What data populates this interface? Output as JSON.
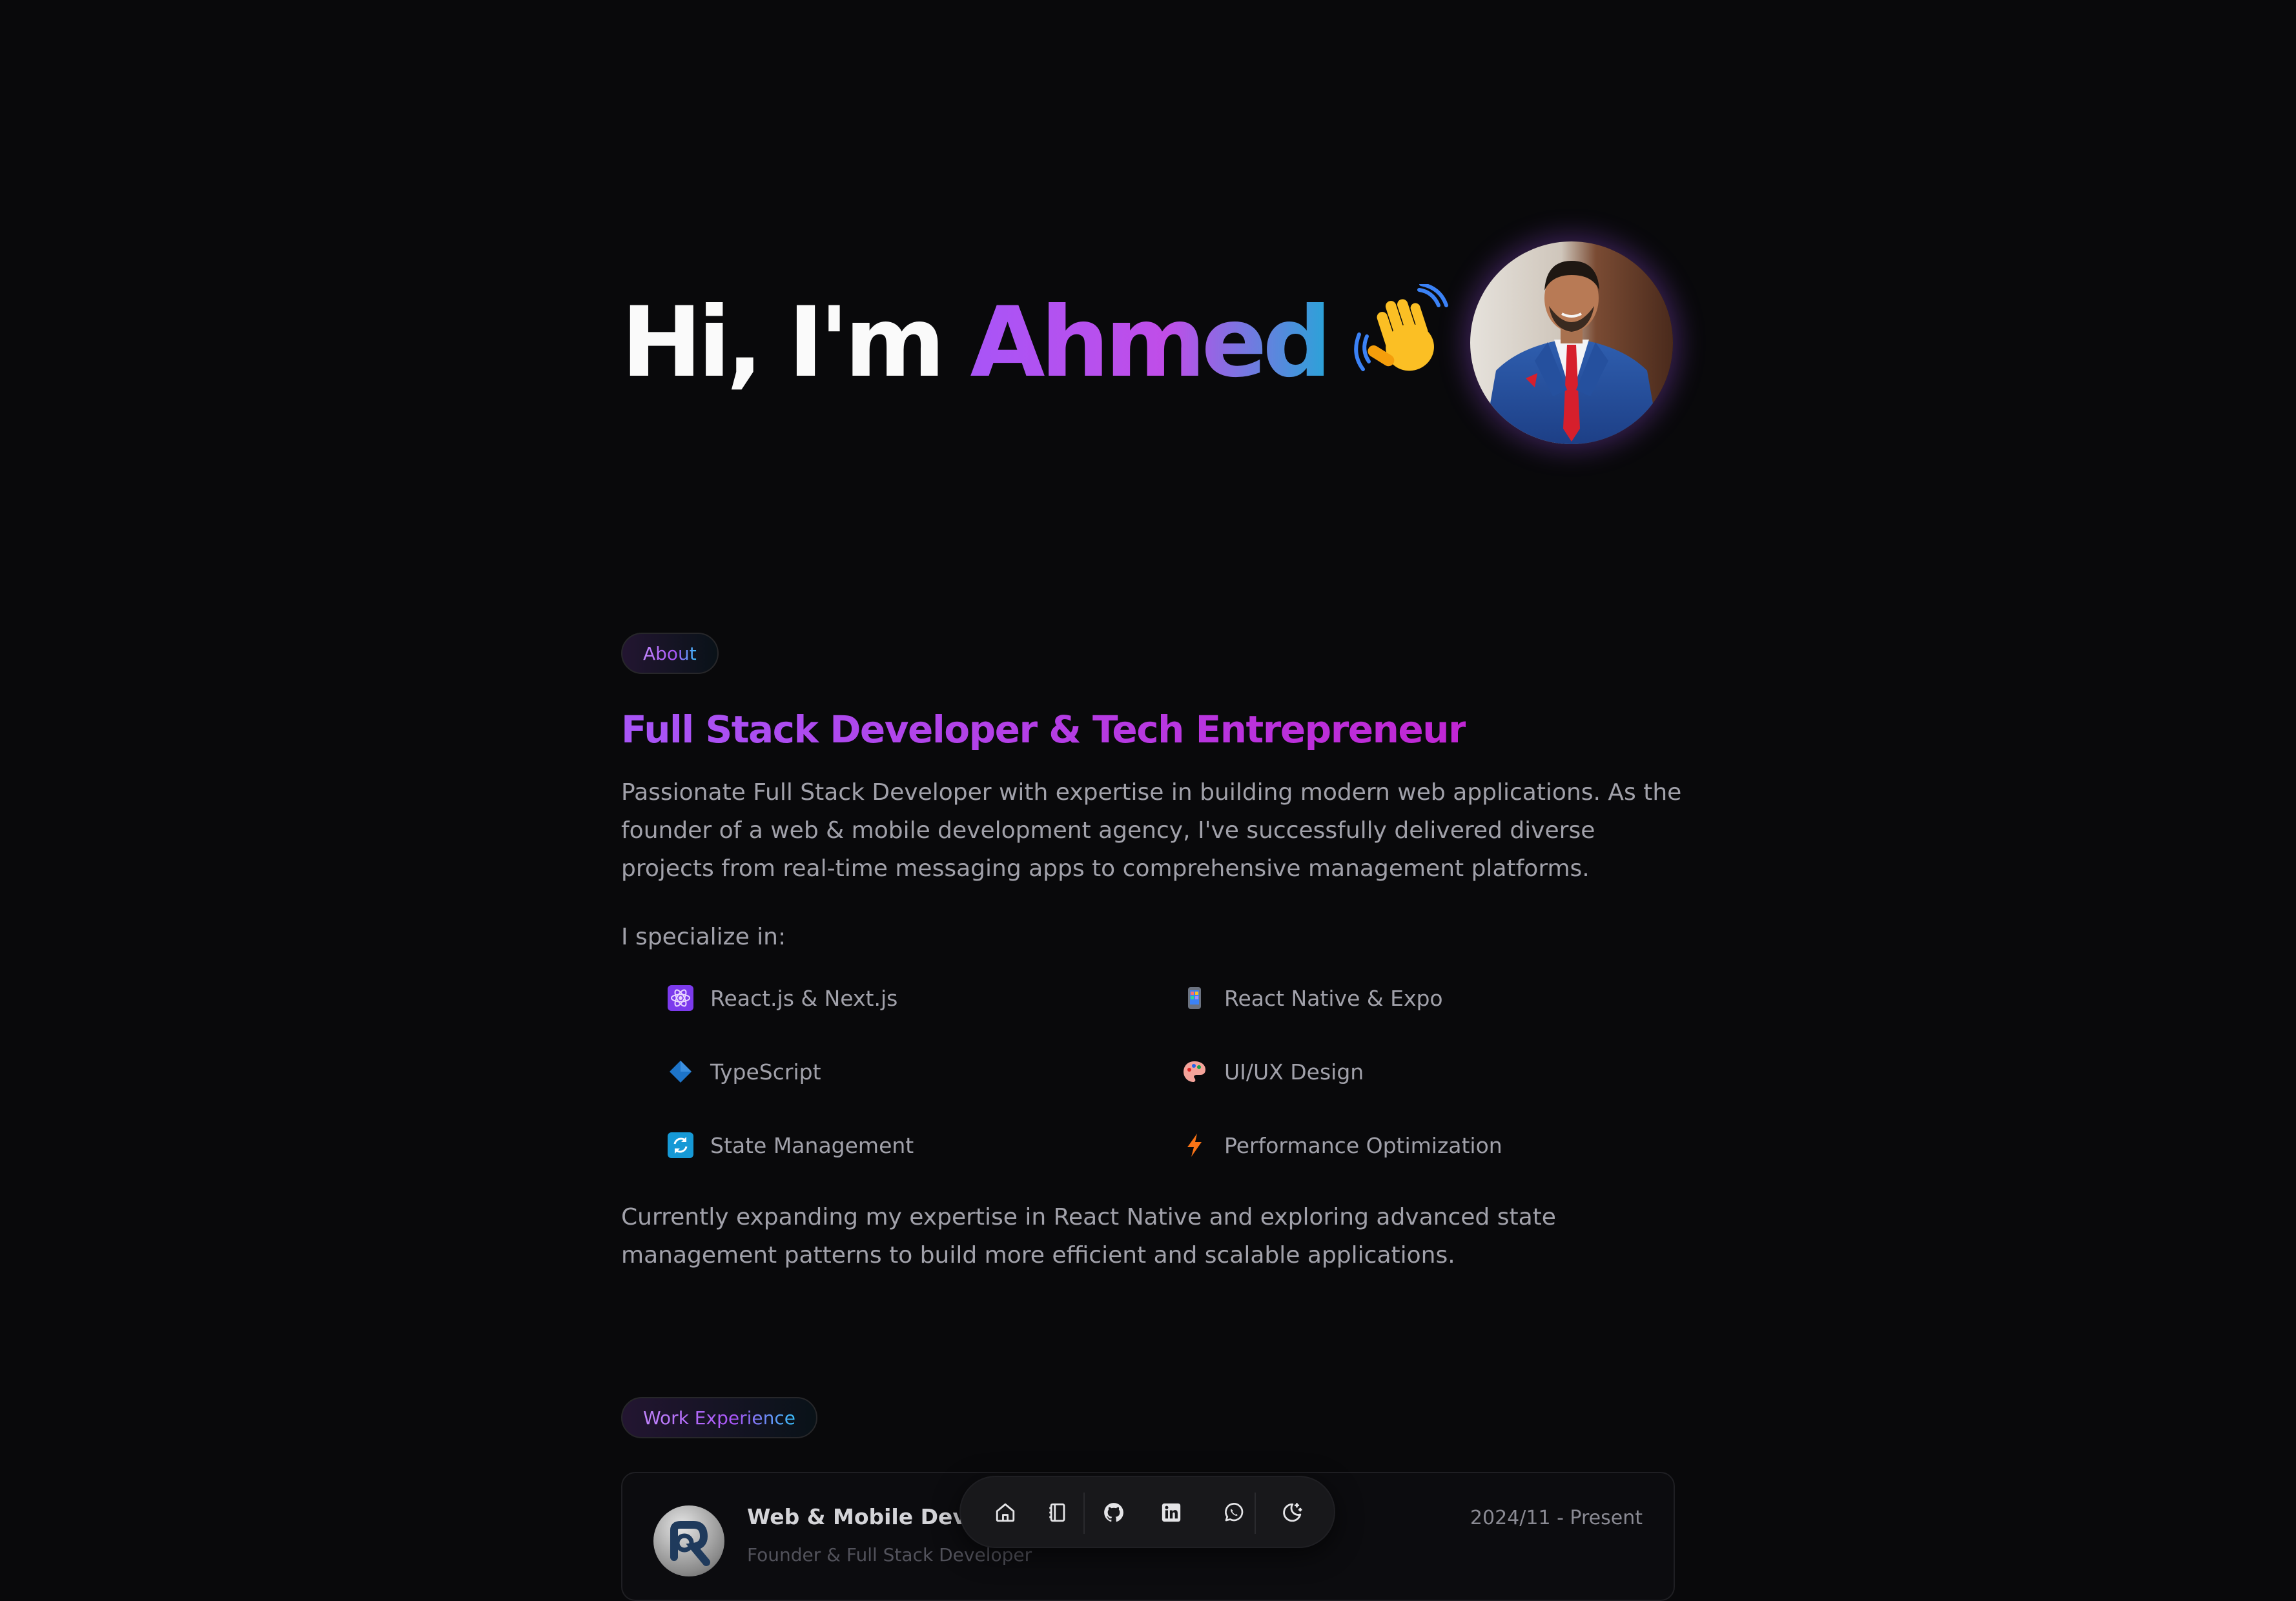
{
  "hero": {
    "greeting": "Hi, I'm",
    "name": "Ahmed",
    "emoji": "waving-hand"
  },
  "about": {
    "badge": "About",
    "heading": "Full Stack Developer & Tech Entrepreneur",
    "intro": "Passionate Full Stack Developer with expertise in building modern web applications. As the founder of a web & mobile development agency, I've successfully delivered diverse projects from real-time messaging apps to comprehensive management platforms.",
    "specialize_label": "I specialize in:",
    "skills": [
      {
        "label": "React.js & Next.js",
        "icon": "atom-icon"
      },
      {
        "label": "React Native & Expo",
        "icon": "mobile-phone-icon"
      },
      {
        "label": "TypeScript",
        "icon": "blue-diamond-icon"
      },
      {
        "label": "UI/UX Design",
        "icon": "palette-icon"
      },
      {
        "label": "State Management",
        "icon": "arrows-cycle-icon"
      },
      {
        "label": "Performance Optimization",
        "icon": "lightning-icon"
      }
    ],
    "outro": "Currently expanding my expertise in React Native and exploring advanced state management patterns to build more efficient and scalable applications."
  },
  "work": {
    "badge": "Work Experience",
    "items": [
      {
        "company": "Web & Mobile Develop",
        "role": "Founder & Full Stack Developer",
        "date": "2024/11 - Present"
      }
    ]
  },
  "dock": {
    "items": [
      "home-icon",
      "notebook-icon",
      "github-icon",
      "linkedin-icon",
      "whatsapp-icon",
      "moon-stars-icon"
    ]
  },
  "colors": {
    "background": "#09090b",
    "accent_purple": "#a855f7",
    "accent_blue": "#2aa3d8",
    "muted_text": "#a1a1aa"
  }
}
